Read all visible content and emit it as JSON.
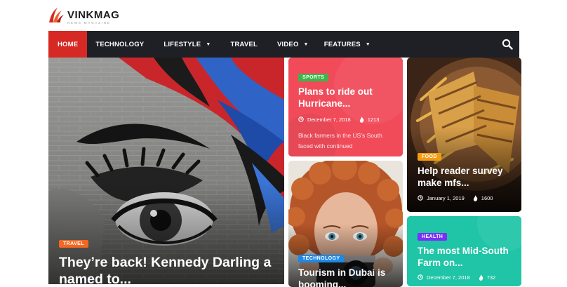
{
  "brand": {
    "name": "VINKMAG",
    "tagline": "NEWS MAGAZINE",
    "accent_color": "#d72924"
  },
  "nav": {
    "items": [
      {
        "label": "HOME",
        "active": true,
        "dropdown": false
      },
      {
        "label": "TECHNOLOGY",
        "active": false,
        "dropdown": false
      },
      {
        "label": "LIFESTYLE",
        "active": false,
        "dropdown": true
      },
      {
        "label": "TRAVEL",
        "active": false,
        "dropdown": false
      },
      {
        "label": "VIDEO",
        "active": false,
        "dropdown": true
      },
      {
        "label": "FEATURES",
        "active": false,
        "dropdown": true
      }
    ],
    "search_icon": "search-icon",
    "background": "#1f2026"
  },
  "posts": {
    "hero": {
      "category": "TRAVEL",
      "category_color": "#f26722",
      "title": "They’re back! Kennedy Darling a named to..."
    },
    "sports": {
      "category": "SPORTS",
      "category_color": "#3bb54a",
      "title": "Plans to ride out Hurricane...",
      "date": "December 7, 2018",
      "views": "1213",
      "excerpt": "Black farmers in the US’s South faced with continued",
      "background": "#f14b5a"
    },
    "food": {
      "category": "FOOD",
      "category_color": "#f39c12",
      "title": "Help reader survey make mfs...",
      "date": "January 1, 2019",
      "views": "1600"
    },
    "technology": {
      "category": "TECHNOLOGY",
      "category_color": "#1e88e5",
      "title": "Tourism in Dubai is booming..."
    },
    "health": {
      "category": "HEALTH",
      "category_color": "#7b2ff7",
      "title": "The most Mid-South Farm on...",
      "date": "December 7, 2018",
      "views": "732",
      "background": "#1fc5a6"
    }
  }
}
